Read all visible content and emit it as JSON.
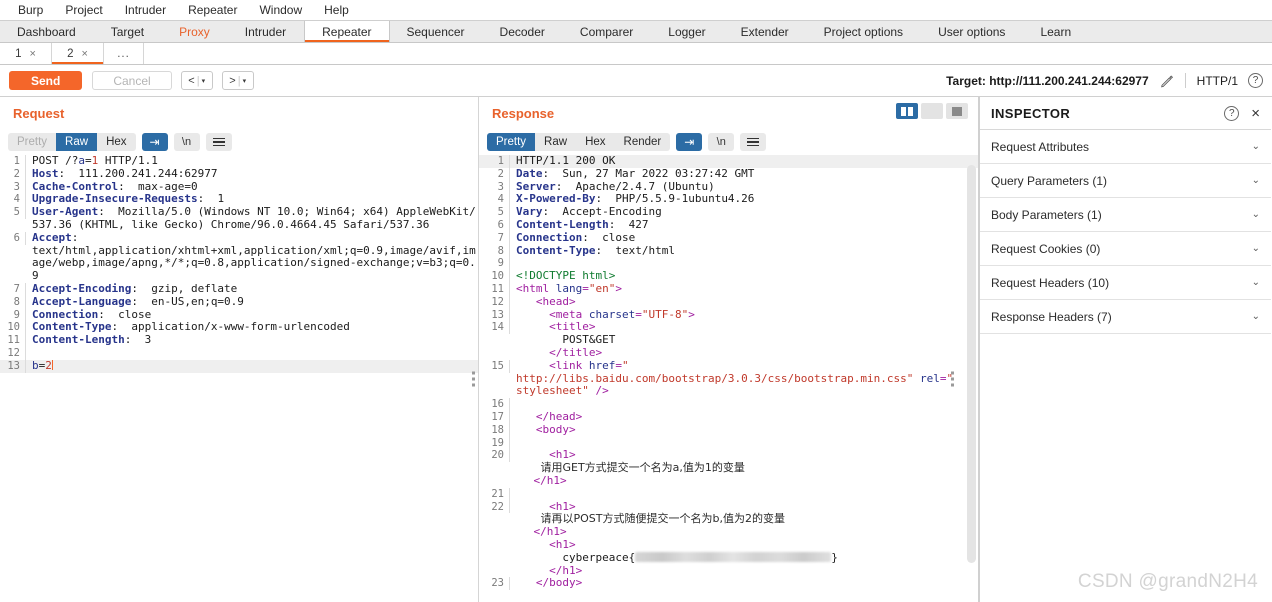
{
  "menubar": {
    "items": [
      "Burp",
      "Project",
      "Intruder",
      "Repeater",
      "Window",
      "Help"
    ]
  },
  "main_tabs": [
    {
      "label": "Dashboard",
      "state": "normal"
    },
    {
      "label": "Target",
      "state": "normal"
    },
    {
      "label": "Proxy",
      "state": "proxy"
    },
    {
      "label": "Intruder",
      "state": "normal"
    },
    {
      "label": "Repeater",
      "state": "active"
    },
    {
      "label": "Sequencer",
      "state": "normal"
    },
    {
      "label": "Decoder",
      "state": "normal"
    },
    {
      "label": "Comparer",
      "state": "normal"
    },
    {
      "label": "Logger",
      "state": "normal"
    },
    {
      "label": "Extender",
      "state": "normal"
    },
    {
      "label": "Project options",
      "state": "normal"
    },
    {
      "label": "User options",
      "state": "normal"
    },
    {
      "label": "Learn",
      "state": "normal"
    }
  ],
  "sub_tabs": [
    {
      "label": "1",
      "close": "×",
      "active": false
    },
    {
      "label": "2",
      "close": "×",
      "active": true
    },
    {
      "label": "...",
      "active": false
    }
  ],
  "actionbar": {
    "send_label": "Send",
    "cancel_label": "Cancel",
    "prev_label": "<",
    "next_label": ">",
    "caret": "▾",
    "separator": "|",
    "target_label": "Target: http://111.200.241.244:62977",
    "pencil_icon": "pencil-icon",
    "http_version": "HTTP/1",
    "help_glyph": "?"
  },
  "request": {
    "title": "Request",
    "view_tabs": [
      {
        "label": "Pretty",
        "state": "disabled"
      },
      {
        "label": "Raw",
        "state": "active"
      },
      {
        "label": "Hex",
        "state": "normal"
      }
    ],
    "wrap_button": "⇥",
    "newline_button": "\\n",
    "menu_button": "hamburger-icon",
    "lines": [
      {
        "n": "1",
        "segs": [
          {
            "c": "v",
            "t": "POST /?"
          },
          {
            "c": "pn",
            "t": "a"
          },
          {
            "c": "v",
            "t": "="
          },
          {
            "c": "pv",
            "t": "1"
          },
          {
            "c": "v",
            "t": " HTTP/1.1"
          }
        ]
      },
      {
        "n": "2",
        "segs": [
          {
            "c": "k",
            "t": "Host"
          },
          {
            "c": "v",
            "t": ":  111.200.241.244:62977"
          }
        ]
      },
      {
        "n": "3",
        "segs": [
          {
            "c": "k",
            "t": "Cache-Control"
          },
          {
            "c": "v",
            "t": ":  max-age=0"
          }
        ]
      },
      {
        "n": "4",
        "segs": [
          {
            "c": "k",
            "t": "Upgrade-Insecure-Requests"
          },
          {
            "c": "v",
            "t": ":  1"
          }
        ]
      },
      {
        "n": "5",
        "segs": [
          {
            "c": "k",
            "t": "User-Agent"
          },
          {
            "c": "v",
            "t": ":  Mozilla/5.0 (Windows NT 10.0; Win64; x64) AppleWebKit/537.36 (KHTML, like Gecko) Chrome/96.0.4664.45 Safari/537.36"
          }
        ]
      },
      {
        "n": "6",
        "segs": [
          {
            "c": "k",
            "t": "Accept"
          },
          {
            "c": "v",
            "t": ":\ntext/html,application/xhtml+xml,application/xml;q=0.9,image/avif,image/webp,image/apng,*/*;q=0.8,application/signed-exchange;v=b3;q=0.9"
          }
        ]
      },
      {
        "n": "7",
        "segs": [
          {
            "c": "k",
            "t": "Accept-Encoding"
          },
          {
            "c": "v",
            "t": ":  gzip, deflate"
          }
        ]
      },
      {
        "n": "8",
        "segs": [
          {
            "c": "k",
            "t": "Accept-Language"
          },
          {
            "c": "v",
            "t": ":  en-US,en;q=0.9"
          }
        ]
      },
      {
        "n": "9",
        "segs": [
          {
            "c": "k",
            "t": "Connection"
          },
          {
            "c": "v",
            "t": ":  close"
          }
        ]
      },
      {
        "n": "10",
        "segs": [
          {
            "c": "k",
            "t": "Content-Type"
          },
          {
            "c": "v",
            "t": ":  application/x-www-form-urlencoded"
          }
        ]
      },
      {
        "n": "11",
        "segs": [
          {
            "c": "k",
            "t": "Content-Length"
          },
          {
            "c": "v",
            "t": ":  3"
          }
        ]
      },
      {
        "n": "12",
        "segs": []
      },
      {
        "n": "13",
        "highlight": true,
        "caret": true,
        "segs": [
          {
            "c": "pn",
            "t": "b"
          },
          {
            "c": "v",
            "t": "="
          },
          {
            "c": "pv",
            "t": "2"
          }
        ]
      }
    ]
  },
  "response": {
    "title": "Response",
    "view_tabs": [
      {
        "label": "Pretty",
        "state": "active"
      },
      {
        "label": "Raw",
        "state": "normal"
      },
      {
        "label": "Hex",
        "state": "normal"
      },
      {
        "label": "Render",
        "state": "normal"
      }
    ],
    "wrap_button": "⇥",
    "newline_button": "\\n",
    "menu_button": "hamburger-icon",
    "layout_buttons": [
      {
        "name": "split-vertical-layout",
        "active": true
      },
      {
        "name": "split-horizontal-layout",
        "active": false
      },
      {
        "name": "single-pane-layout",
        "active": false
      }
    ],
    "lines": [
      {
        "n": "1",
        "highlight": true,
        "segs": [
          {
            "c": "v",
            "t": "HTTP/1.1 200 OK"
          }
        ]
      },
      {
        "n": "2",
        "segs": [
          {
            "c": "k",
            "t": "Date"
          },
          {
            "c": "v",
            "t": ":  Sun, 27 Mar 2022 03:27:42 GMT"
          }
        ]
      },
      {
        "n": "3",
        "segs": [
          {
            "c": "k",
            "t": "Server"
          },
          {
            "c": "v",
            "t": ":  Apache/2.4.7 (Ubuntu)"
          }
        ]
      },
      {
        "n": "4",
        "segs": [
          {
            "c": "k",
            "t": "X-Powered-By"
          },
          {
            "c": "v",
            "t": ":  PHP/5.5.9-1ubuntu4.26"
          }
        ]
      },
      {
        "n": "5",
        "segs": [
          {
            "c": "k",
            "t": "Vary"
          },
          {
            "c": "v",
            "t": ":  Accept-Encoding"
          }
        ]
      },
      {
        "n": "6",
        "segs": [
          {
            "c": "k",
            "t": "Content-Length"
          },
          {
            "c": "v",
            "t": ":  427"
          }
        ]
      },
      {
        "n": "7",
        "segs": [
          {
            "c": "k",
            "t": "Connection"
          },
          {
            "c": "v",
            "t": ":  close"
          }
        ]
      },
      {
        "n": "8",
        "segs": [
          {
            "c": "k",
            "t": "Content-Type"
          },
          {
            "c": "v",
            "t": ":  text/html"
          }
        ]
      },
      {
        "n": "9",
        "segs": []
      },
      {
        "n": "10",
        "segs": [
          {
            "c": "doct",
            "t": "<!DOCTYPE html>"
          }
        ]
      },
      {
        "n": "11",
        "segs": [
          {
            "c": "tag",
            "t": "<html "
          },
          {
            "c": "att",
            "t": "lang"
          },
          {
            "c": "tag",
            "t": "="
          },
          {
            "c": "str",
            "t": "\"en\""
          },
          {
            "c": "tag",
            "t": ">"
          }
        ]
      },
      {
        "n": "12",
        "segs": [
          {
            "c": "tag",
            "t": "   <head>"
          }
        ]
      },
      {
        "n": "13",
        "segs": [
          {
            "c": "tag",
            "t": "     <meta "
          },
          {
            "c": "att",
            "t": "charset"
          },
          {
            "c": "tag",
            "t": "="
          },
          {
            "c": "str",
            "t": "\"UTF-8\""
          },
          {
            "c": "tag",
            "t": ">"
          }
        ]
      },
      {
        "n": "14",
        "segs": [
          {
            "c": "tag",
            "t": "     <title>"
          },
          {
            "c": "txt",
            "t": "\n       POST&GET\n     "
          },
          {
            "c": "tag",
            "t": "</title>"
          }
        ]
      },
      {
        "n": "15",
        "segs": [
          {
            "c": "tag",
            "t": "     <link "
          },
          {
            "c": "att",
            "t": "href"
          },
          {
            "c": "tag",
            "t": "="
          },
          {
            "c": "str",
            "t": "\"\nhttp://libs.baidu.com/bootstrap/3.0.3/css/bootstrap.min.css\""
          },
          {
            "c": "tag",
            "t": " "
          },
          {
            "c": "att",
            "t": "rel"
          },
          {
            "c": "tag",
            "t": "="
          },
          {
            "c": "str",
            "t": "\"\nstylesheet\""
          },
          {
            "c": "tag",
            "t": " />"
          }
        ]
      },
      {
        "n": "16",
        "segs": []
      },
      {
        "n": "17",
        "segs": [
          {
            "c": "tag",
            "t": "   </head>"
          }
        ]
      },
      {
        "n": "18",
        "segs": [
          {
            "c": "tag",
            "t": "   <body>"
          }
        ]
      },
      {
        "n": "19",
        "segs": []
      },
      {
        "n": "20",
        "segs": [
          {
            "c": "tag",
            "t": "     <h1>"
          },
          {
            "c": "cn",
            "t": "\n       请用GET方式提交一个名为a,值为1的变量\n     "
          },
          {
            "c": "tag",
            "t": "</h1>"
          }
        ]
      },
      {
        "n": "21",
        "segs": []
      },
      {
        "n": "22",
        "segs": [
          {
            "c": "tag",
            "t": "     <h1>"
          },
          {
            "c": "cn",
            "t": "\n       请再以POST方式随便提交一个名为b,值为2的变量\n     "
          },
          {
            "c": "tag",
            "t": "</h1>\n     <h1>"
          },
          {
            "c": "txt",
            "t": "\n       cyberpeace{"
          },
          {
            "c": "redact",
            "t": ""
          },
          {
            "c": "txt",
            "t": "}\n     "
          },
          {
            "c": "tag",
            "t": "</h1>"
          }
        ]
      },
      {
        "n": "23",
        "segs": [
          {
            "c": "tag",
            "t": "   </body>"
          }
        ]
      }
    ]
  },
  "inspector": {
    "title": "INSPECTOR",
    "help_glyph": "?",
    "close_glyph": "×",
    "chevron": "⌄",
    "sections": [
      {
        "label": "Request Attributes"
      },
      {
        "label": "Query Parameters (1)"
      },
      {
        "label": "Body Parameters (1)"
      },
      {
        "label": "Request Cookies (0)"
      },
      {
        "label": "Request Headers (10)"
      },
      {
        "label": "Response Headers (7)"
      }
    ]
  },
  "watermark": "CSDN @grandN2H4"
}
